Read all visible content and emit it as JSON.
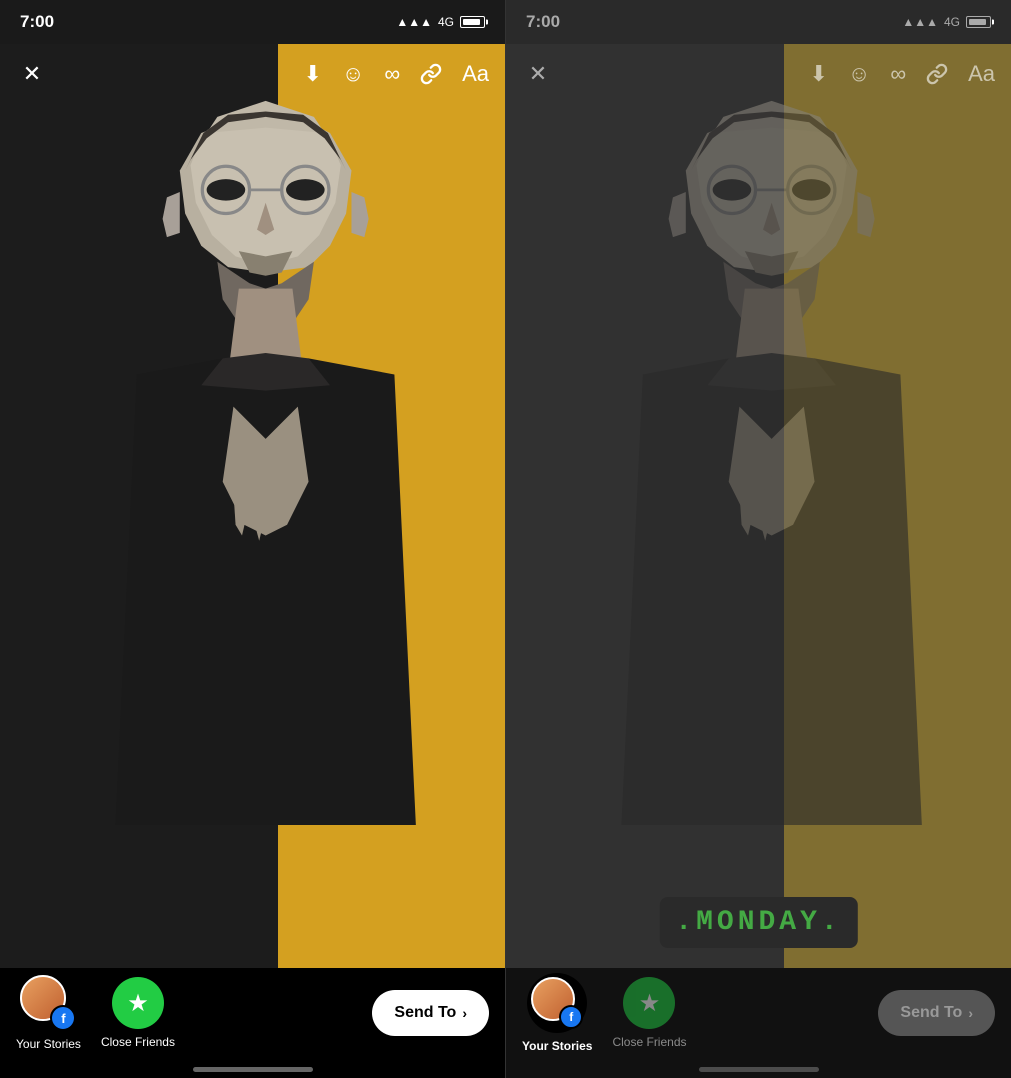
{
  "left_phone": {
    "status": {
      "time": "7:00",
      "network": "4G"
    },
    "toolbar": {
      "close": "✕",
      "download": "⬇",
      "sticker": "☺",
      "boomerang": "∞",
      "link": "🔗",
      "text": "Aa"
    },
    "bottom": {
      "your_stories_label": "Your Stories",
      "close_friends_label": "Close Friends",
      "send_to_label": "Send To",
      "send_to_arrow": "›"
    }
  },
  "right_phone": {
    "status": {
      "time": "7:00",
      "network": "4G"
    },
    "toolbar": {
      "close": "✕",
      "download": "⬇",
      "sticker": "☺",
      "boomerang": "∞",
      "link": "🔗",
      "text": "Aa"
    },
    "monday_display": ".MONDAY.",
    "bottom": {
      "your_stories_label": "Your Stories",
      "close_friends_label": "Close Friends",
      "send_to_label": "Send To",
      "send_to_arrow": "›"
    }
  }
}
